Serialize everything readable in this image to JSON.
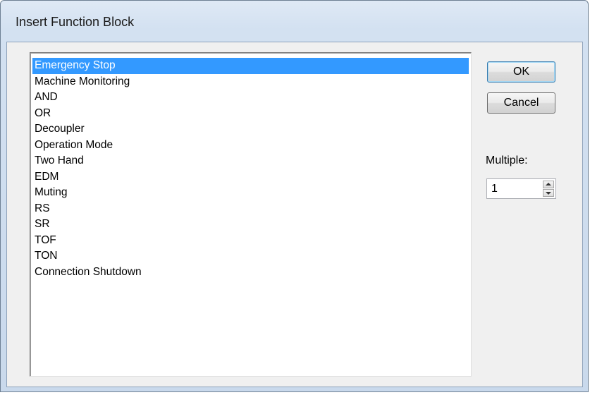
{
  "window": {
    "title": "Insert Function Block"
  },
  "list": {
    "selected_index": 0,
    "items": [
      "Emergency Stop",
      "Machine Monitoring",
      "AND",
      "OR",
      "Decoupler",
      "Operation Mode",
      "Two Hand",
      "EDM",
      "Muting",
      "RS",
      "SR",
      "TOF",
      "TON",
      "Connection Shutdown"
    ]
  },
  "buttons": {
    "ok_label": "OK",
    "cancel_label": "Cancel"
  },
  "multiple": {
    "label": "Multiple:",
    "value": "1"
  },
  "icons": {
    "spin_up": "chevron-up-icon",
    "spin_down": "chevron-down-icon"
  },
  "colors": {
    "selection": "#3399ff",
    "title_bar": "#dfe9f5"
  }
}
